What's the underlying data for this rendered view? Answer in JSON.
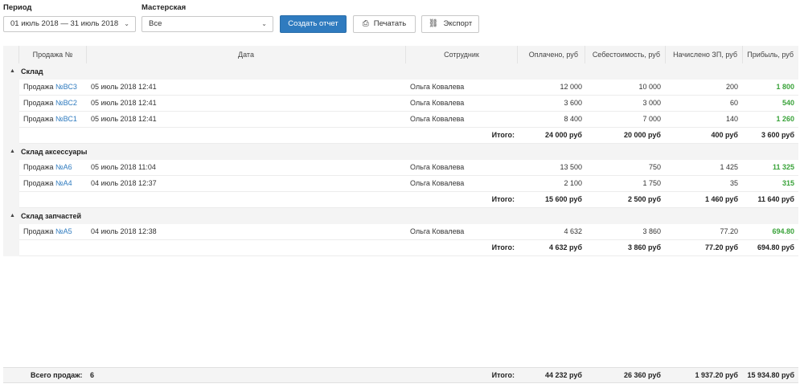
{
  "filters": {
    "period_label": "Период",
    "period_value": "01 июль 2018 — 31 июль 2018",
    "workshop_label": "Мастерская",
    "workshop_value": "Все",
    "create_btn": "Создать отчет",
    "print_btn": "Печатать",
    "export_btn": "Экспорт"
  },
  "table": {
    "headers": {
      "sale": "Продажа №",
      "date": "Дата",
      "employee": "Сотрудник",
      "paid": "Оплачено, руб",
      "cost": "Себестоимость, руб",
      "salary": "Начислено ЗП, руб",
      "profit": "Прибыль, руб"
    },
    "groups": [
      {
        "name": "Склад",
        "rows": [
          {
            "sale_prefix": "Продажа",
            "sale_no": "№ВС3",
            "date": "05 июль 2018 12:41",
            "employee": "Ольга Ковалева",
            "paid": "12 000",
            "cost": "10 000",
            "salary": "200",
            "profit": "1 800"
          },
          {
            "sale_prefix": "Продажа",
            "sale_no": "№ВС2",
            "date": "05 июль 2018 12:41",
            "employee": "Ольга Ковалева",
            "paid": "3 600",
            "cost": "3 000",
            "salary": "60",
            "profit": "540"
          },
          {
            "sale_prefix": "Продажа",
            "sale_no": "№ВС1",
            "date": "05 июль 2018 12:41",
            "employee": "Ольга Ковалева",
            "paid": "8 400",
            "cost": "7 000",
            "salary": "140",
            "profit": "1 260"
          }
        ],
        "total": {
          "label": "Итого:",
          "paid": "24 000 руб",
          "cost": "20 000 руб",
          "salary": "400 руб",
          "profit": "3 600 руб"
        }
      },
      {
        "name": "Склад аксессуары",
        "rows": [
          {
            "sale_prefix": "Продажа",
            "sale_no": "№А6",
            "date": "05 июль 2018 11:04",
            "employee": "Ольга Ковалева",
            "paid": "13 500",
            "cost": "750",
            "salary": "1 425",
            "profit": "11 325"
          },
          {
            "sale_prefix": "Продажа",
            "sale_no": "№А4",
            "date": "04 июль 2018 12:37",
            "employee": "Ольга Ковалева",
            "paid": "2 100",
            "cost": "1 750",
            "salary": "35",
            "profit": "315"
          }
        ],
        "total": {
          "label": "Итого:",
          "paid": "15 600 руб",
          "cost": "2 500 руб",
          "salary": "1 460 руб",
          "profit": "11 640 руб"
        }
      },
      {
        "name": "Склад запчастей",
        "rows": [
          {
            "sale_prefix": "Продажа",
            "sale_no": "№А5",
            "date": "04 июль 2018 12:38",
            "employee": "Ольга Ковалева",
            "paid": "4 632",
            "cost": "3 860",
            "salary": "77.20",
            "profit": "694.80"
          }
        ],
        "total": {
          "label": "Итого:",
          "paid": "4 632 руб",
          "cost": "3 860 руб",
          "salary": "77.20 руб",
          "profit": "694.80 руб"
        }
      }
    ],
    "footer": {
      "sales_label": "Всего продаж:",
      "sales_count": "6",
      "label": "Итого:",
      "paid": "44 232 руб",
      "cost": "26 360 руб",
      "salary": "1 937.20 руб",
      "profit": "15 934.80 руб"
    }
  },
  "colors": {
    "accent": "#2f7bbf",
    "profit": "#3aa33a"
  }
}
